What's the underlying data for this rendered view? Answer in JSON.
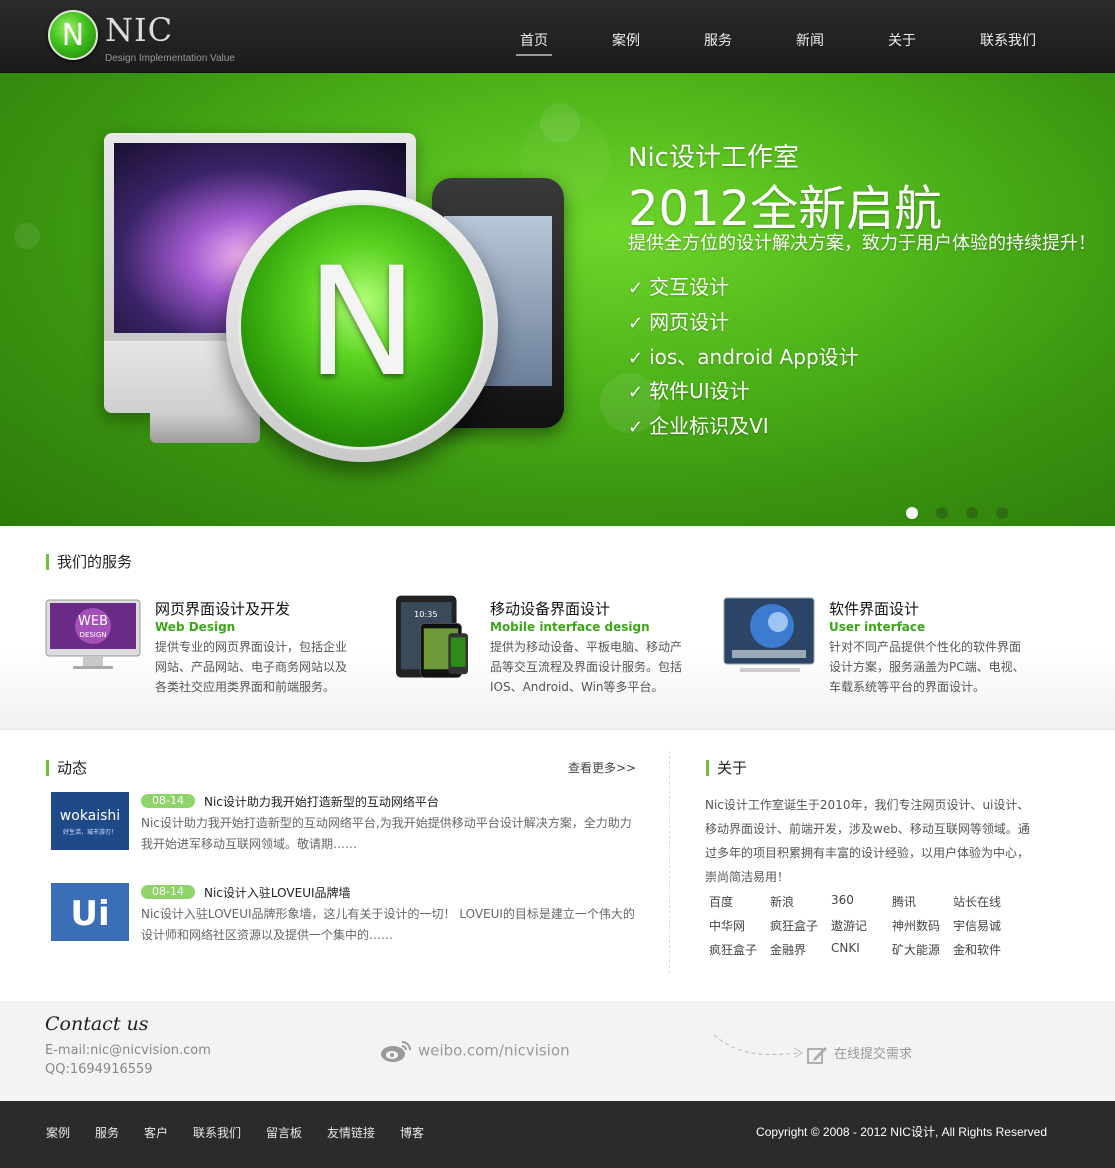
{
  "header": {
    "logo_letter": "N",
    "logo_text": "NIC",
    "logo_sub": "Design Implementation Value",
    "nav": [
      {
        "label": "首页",
        "active": true
      },
      {
        "label": "案例"
      },
      {
        "label": "服务"
      },
      {
        "label": "新闻"
      },
      {
        "label": "关于"
      },
      {
        "label": "联系我们"
      }
    ]
  },
  "banner": {
    "logo_letter": "N",
    "heading_small": "Nic设计工作室",
    "heading_big": "2012全新启航",
    "tagline": "提供全方位的设计解决方案，致力于用户体验的持续提升！",
    "check_mark": "✓",
    "features": [
      "交互设计",
      "网页设计",
      "ios、android App设计",
      "软件UI设计",
      "企业标识及VI"
    ],
    "slides": 4,
    "active_slide": 1
  },
  "services": {
    "title": "我们的服务",
    "items": [
      {
        "title": "网页界面设计及开发",
        "en": "Web Design",
        "desc": "提供专业的网页界面设计，包括企业网站、产品网站、电子商务网站以及各类社交应用类界面和前端服务。",
        "icon": "web-design-monitor-icon"
      },
      {
        "title": "移动设备界面设计",
        "en": "Mobile interface design",
        "desc": "提供为移动设备、平板电脑、移动产品等交互流程及界面设计服务。包括IOS、Android、Win等多平台。",
        "icon": "mobile-devices-icon"
      },
      {
        "title": "软件界面设计",
        "en": "User interface",
        "desc": "针对不同产品提供个性化的软件界面设计方案，服务涵盖为PC端、电视、车载系统等平台的界面设计。",
        "icon": "software-ui-screen-icon"
      }
    ]
  },
  "news": {
    "title": "动态",
    "more": "查看更多>>",
    "items": [
      {
        "date": "08-14",
        "title": "Nic设计助力我开始打造新型的互动网络平台",
        "desc": "Nic设计助力我开始打造新型的互动网络平台,为我开始提供移动平台设计解决方案，全力助力我开始进军移动互联网领域。敬请期……",
        "thumb_text": "wokaishi",
        "thumb_sub": "好生活，城市游刃！"
      },
      {
        "date": "08-14",
        "title": "Nic设计入驻LOVEUI品牌墙",
        "desc": "Nic设计入驻LOVEUI品牌形象墙，这儿有关于设计的一切！ LOVEUI的目标是建立一个伟大的设计师和网络社区资源以及提供一个集中的……",
        "thumb_text": "Ui",
        "thumb_sub": ""
      }
    ]
  },
  "about": {
    "title": "关于",
    "text": "Nic设计工作室诞生于2010年，我们专注网页设计、ui设计、移动界面设计、前端开发，涉及web、移动互联网等领域。通过多年的项目积累拥有丰富的设计经验，以用户体验为中心，崇尚简洁易用！",
    "clients": [
      "百度",
      "新浪",
      "360",
      "腾讯",
      "站长在线",
      "中华网",
      "疯狂盒子",
      "遨游记",
      "神州数码",
      "宇信易诚",
      "疯狂盒子",
      "金融界",
      "CNKI",
      "矿大能源",
      "金和软件"
    ]
  },
  "contact": {
    "title": "Contact us",
    "email": "E-mail:nic@nicvision.com",
    "qq": "QQ:1694916559",
    "weibo": "weibo.com/nicvision",
    "submit": "在线提交需求"
  },
  "footer": {
    "links": [
      "案例",
      "服务",
      "客户",
      "联系我们",
      "留言板",
      "友情链接",
      "博客"
    ],
    "copyright": "Copyright © 2008 - 2012 NIC设计, All Rights Reserved"
  },
  "colors": {
    "accent_green": "#6fc03a",
    "badge_green": "#8fd46a",
    "header_bg": "#222222",
    "footer_bg": "#2b2b2b"
  }
}
